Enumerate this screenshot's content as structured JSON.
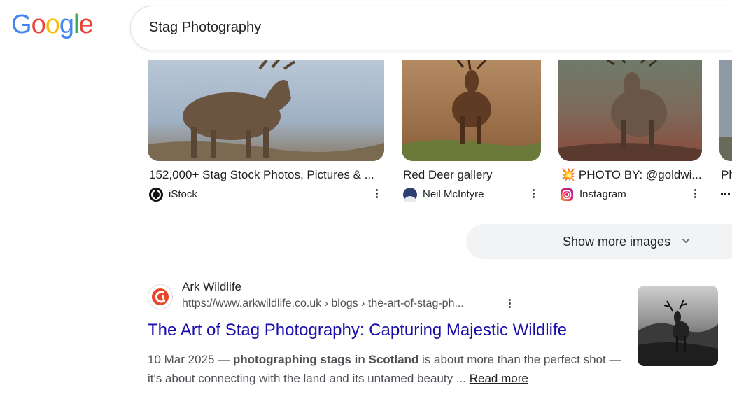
{
  "header": {
    "logo": [
      "G",
      "o",
      "o",
      "g",
      "l",
      "e"
    ],
    "search_query": "Stag Photography"
  },
  "colors": {
    "logo": [
      "#4285F4",
      "#EA4335",
      "#FBBC05",
      "#4285F4",
      "#34A853",
      "#EA4335"
    ],
    "link": "#1a0dab",
    "snippet": "#4d5156",
    "chip_bg": "#f1f3f4"
  },
  "image_results": [
    {
      "title": "152,000+ Stag Stock Photos, Pictures & ...",
      "source": "iStock",
      "icon": "istock-icon"
    },
    {
      "title": "Red Deer gallery",
      "source": "Neil McIntyre",
      "icon": "neil-mcintyre-avatar-icon"
    },
    {
      "title": "💥 PHOTO BY: @goldwi...",
      "source": "Instagram",
      "icon": "instagram-icon"
    },
    {
      "title": "Ph",
      "source": "",
      "icon": "more-source-icon"
    }
  ],
  "show_more": {
    "label": "Show more images",
    "icon": "chevron-down-icon"
  },
  "result": {
    "site_name": "Ark Wildlife",
    "url": "https://www.arkwildlife.co.uk › blogs › the-art-of-stag-ph...",
    "title": "The Art of Stag Photography: Capturing Majestic Wildlife",
    "date": "10 Mar 2025",
    "snippet_parts": {
      "dash": " — ",
      "bold": "photographing stags in Scotland",
      "rest": " is about more than the perfect shot —it's about connecting with the land and its untamed beauty ... "
    },
    "read_more": "Read more"
  }
}
